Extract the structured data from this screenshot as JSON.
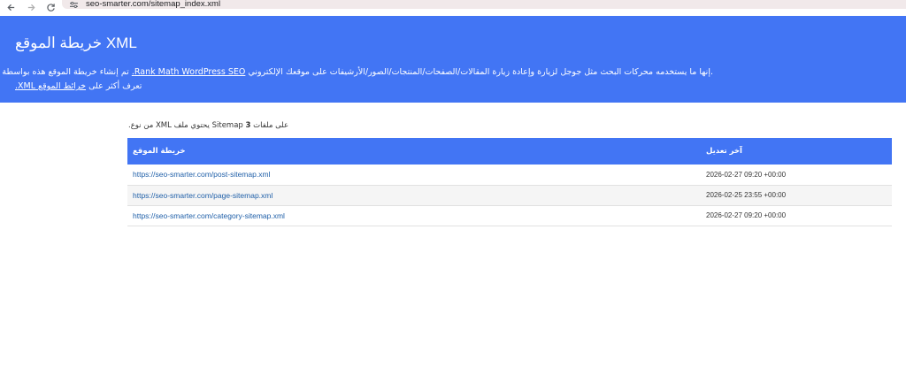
{
  "browser": {
    "url": "seo-smarter.com/sitemap_index.xml"
  },
  "header": {
    "title": "خريطة الموقع XML",
    "line1_text": ".إنها ما يستخدمه محركات البحث مثل جوجل لزيارة وإعادة زيارة المقالات/الصفحات/المنتجات/الصور/الأرشيفات على موقعك الإلكتروني",
    "line1_link": "Rank Math WordPress SEO.",
    "line1_tail": "تم إنشاء خريطة الموقع هذه بواسطة إضافة",
    "line2_pre": "تعرف أكثر على",
    "line2_link": "خرائط الموقع XML."
  },
  "summary": {
    "pre": "على ملفات",
    "count": "3",
    "post": ".من نوع XML  يحتوي ملف Sitemap"
  },
  "table": {
    "col_sitemap": "خريطة الموقع",
    "col_modified": "آخر تعديل",
    "rows": [
      {
        "loc": "https://seo-smarter.com/post-sitemap.xml",
        "lastmod": "2026-02-27 09:20 +00:00"
      },
      {
        "loc": "https://seo-smarter.com/page-sitemap.xml",
        "lastmod": "2026-02-25 23:55 +00:00"
      },
      {
        "loc": "https://seo-smarter.com/category-sitemap.xml",
        "lastmod": "2026-02-27 09:20 +00:00"
      }
    ]
  },
  "icons": {
    "back": "back-arrow-icon",
    "forward": "forward-arrow-icon",
    "reload": "reload-icon",
    "site_info": "site-info-icon"
  },
  "colors": {
    "accent": "#4275f4",
    "link": "#1f5fa8",
    "omnibox": "#f1e9ea"
  }
}
